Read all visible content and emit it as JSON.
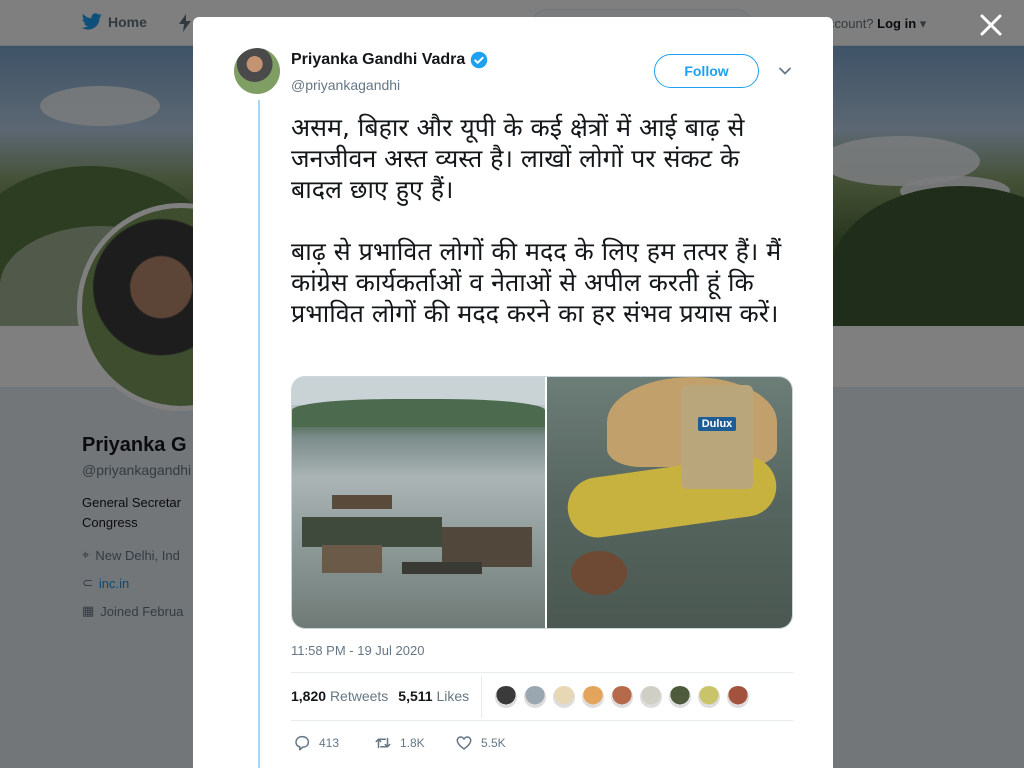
{
  "nav": {
    "home_label": "Home",
    "account_prompt": "ccount?",
    "login_label": "Log in"
  },
  "profile": {
    "name": "Priyanka G",
    "handle": "@priyankagandhi",
    "bio": "General Secretar Congress",
    "location": "New Delhi, Ind",
    "website": "inc.in",
    "joined": "Joined Februa"
  },
  "tweet": {
    "author_name": "Priyanka Gandhi Vadra",
    "author_handle": "@priyankagandhi",
    "verified": true,
    "follow_label": "Follow",
    "text_paragraphs": [
      "असम, बिहार और यूपी के कई क्षेत्रों में आई बाढ़ से जनजीवन अस्त व्यस्त है। लाखों लोगों पर संकट के बादल छाए हुए हैं।",
      "बाढ़ से प्रभावित लोगों की मदद के लिए हम तत्पर हैं। मैं कांग्रेस कार्यकर्ताओं व नेताओं से अपील करती हूं कि प्रभावित लोगों की मदद करने का हर संभव प्रयास करें।"
    ],
    "media_caption_text": "Dulux",
    "timestamp": "11:58 PM - 19 Jul 2020",
    "retweets_count": "1,820",
    "retweets_label": "Retweets",
    "likes_count": "5,511",
    "likes_label": "Likes",
    "replies": "413",
    "retweets_short": "1.8K",
    "likes_short": "5.5K"
  },
  "colors": {
    "brand": "#1da1f2",
    "text": "#14171a",
    "muted": "#657786",
    "thread_line": "#a8d7f8"
  },
  "likers": [
    "#3a3a3a",
    "#9aa7b0",
    "#e7d7b5",
    "#e3a45c",
    "#b56a4b",
    "#d0cfc6",
    "#4d5b3c",
    "#c9c46a",
    "#a3533d"
  ]
}
